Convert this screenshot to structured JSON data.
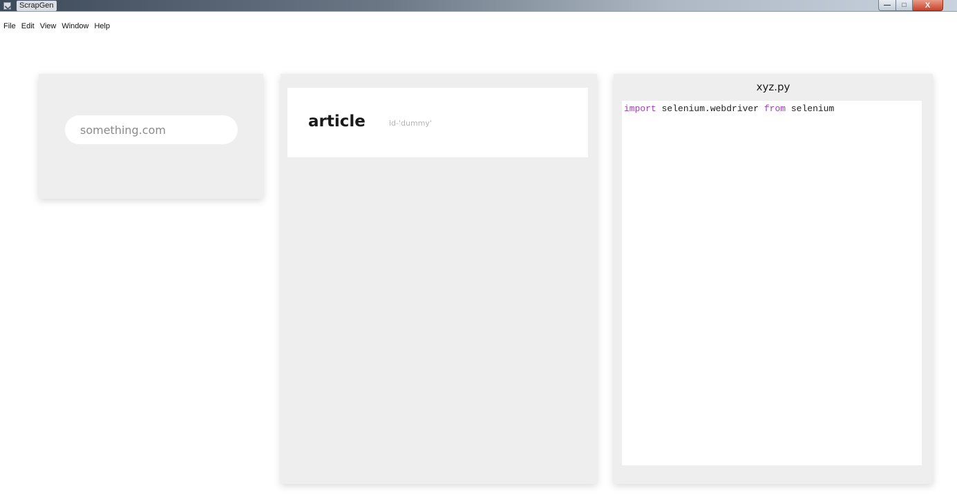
{
  "window": {
    "title": "ScrapGen",
    "icon": "app-window-icon",
    "buttons": {
      "minimize_glyph": "—",
      "maximize_glyph": "□",
      "close_glyph": "X"
    }
  },
  "menu": {
    "items": [
      "File",
      "Edit",
      "View",
      "Window",
      "Help"
    ]
  },
  "url_panel": {
    "input_placeholder": "something.com",
    "input_value": ""
  },
  "elements_panel": {
    "items": [
      {
        "tag": "article",
        "attribute": "id-'dummy'"
      }
    ]
  },
  "code_panel": {
    "filename": "xyz.py",
    "line1": {
      "kw1": "import",
      "text1": " selenium.webdriver ",
      "kw2": "from",
      "text2": " selenium"
    },
    "keyword_color": "#9a3fb5"
  },
  "colors": {
    "panel_bg": "#eeeeee",
    "card_bg": "#ffffff",
    "attribute_text": "#b3b3b3"
  }
}
